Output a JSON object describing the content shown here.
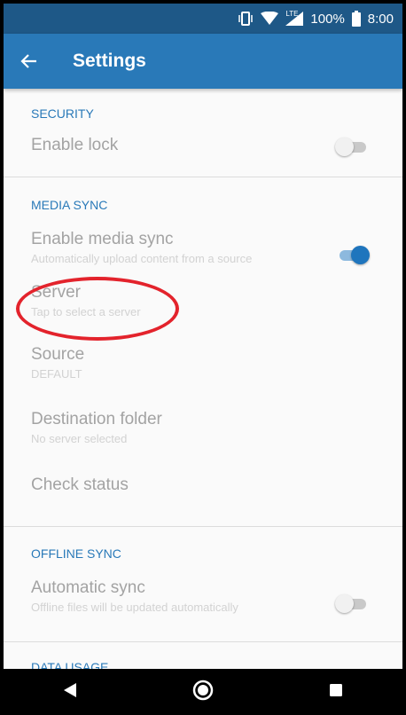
{
  "status_bar": {
    "network": "LTE",
    "battery": "100%",
    "time": "8:00"
  },
  "app_bar": {
    "title": "Settings",
    "back_icon": "arrow-back-icon"
  },
  "sections": {
    "security": {
      "header": "SECURITY",
      "enable_lock": {
        "title": "Enable lock",
        "switch_on": false
      }
    },
    "media_sync": {
      "header": "MEDIA SYNC",
      "enable_media_sync": {
        "title": "Enable media sync",
        "summary": "Automatically upload content from a source",
        "switch_on": true
      },
      "server": {
        "title": "Server",
        "summary": "Tap to select a server"
      },
      "source": {
        "title": "Source",
        "summary": "DEFAULT"
      },
      "destination_folder": {
        "title": "Destination folder",
        "summary": "No server selected"
      },
      "check_status": {
        "title": "Check status"
      }
    },
    "offline_sync": {
      "header": "OFFLINE SYNC",
      "automatic_sync": {
        "title": "Automatic sync",
        "summary": "Offline files will be updated automatically",
        "switch_on": false
      }
    },
    "data_usage": {
      "header": "DATA USAGE"
    }
  },
  "colors": {
    "status_bar": "#1e5887",
    "app_bar": "#2979b8",
    "accent": "#2979b8",
    "annotation": "#e3232c"
  },
  "nav_bar": {
    "back_icon": "triangle-back-icon",
    "home_icon": "circle-home-icon",
    "recents_icon": "square-recents-icon"
  }
}
